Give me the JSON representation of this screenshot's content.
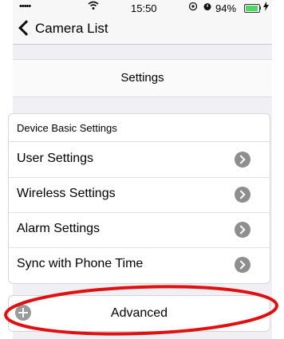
{
  "status_bar": {
    "signal": "•••••",
    "wifi_icon": "wifi-icon",
    "time": "15:50",
    "battery_percent": "94%",
    "battery_level": 94,
    "battery_color": "#4cd964"
  },
  "nav": {
    "back_label": "Camera List"
  },
  "page": {
    "title": "Settings"
  },
  "settings": {
    "section_header": "Device Basic Settings",
    "items": [
      {
        "label": "User Settings"
      },
      {
        "label": "Wireless Settings"
      },
      {
        "label": "Alarm Settings"
      },
      {
        "label": "Sync with Phone Time"
      }
    ]
  },
  "advanced": {
    "label": "Advanced"
  },
  "annotation": {
    "color": "#e01010"
  }
}
